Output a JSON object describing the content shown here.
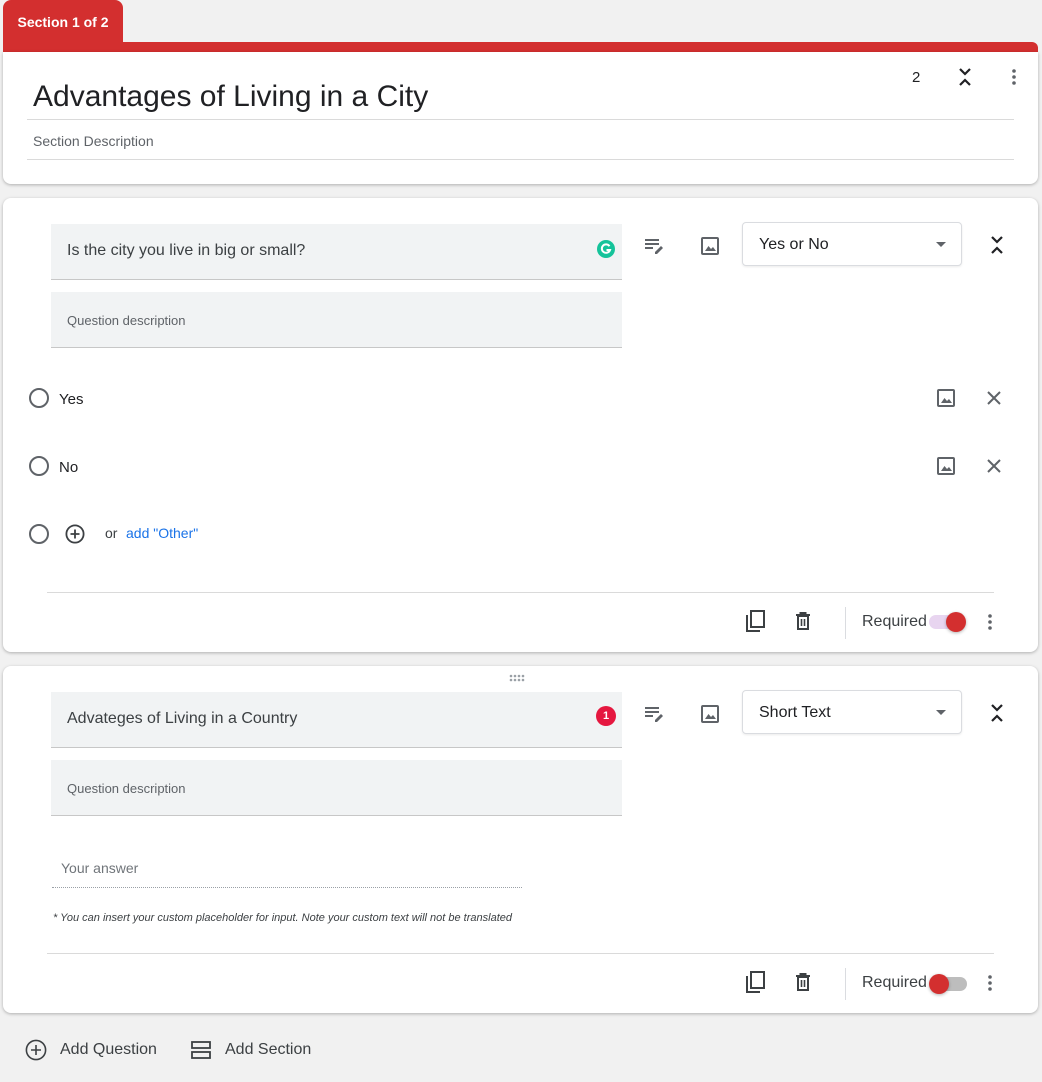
{
  "section": {
    "tab_label": "Section 1 of 2",
    "title": "Advantages of Living in a City",
    "count": "2",
    "description_placeholder": "Section Description"
  },
  "questions": [
    {
      "title": "Is the city you live in big or small?",
      "description_placeholder": "Question description",
      "type": "Yes or No",
      "badge": "grammarly-icon",
      "options": [
        "Yes",
        "No"
      ],
      "or_text": "or",
      "add_other": "add \"Other\"",
      "required_label": "Required",
      "required": true
    },
    {
      "title": "Advateges of Living in a Country",
      "description_placeholder": "Question description",
      "type": "Short Text",
      "badge_count": "1",
      "answer_placeholder": "Your answer",
      "note": "* You can insert your custom placeholder for input. Note your custom text will not be translated",
      "required_label": "Required",
      "required": false
    }
  ],
  "footer": {
    "add_question": "Add Question",
    "add_section": "Add Section"
  },
  "colors": {
    "accent": "#d32f2f",
    "link": "#1a73e8",
    "grammarly": "#15c39a"
  }
}
